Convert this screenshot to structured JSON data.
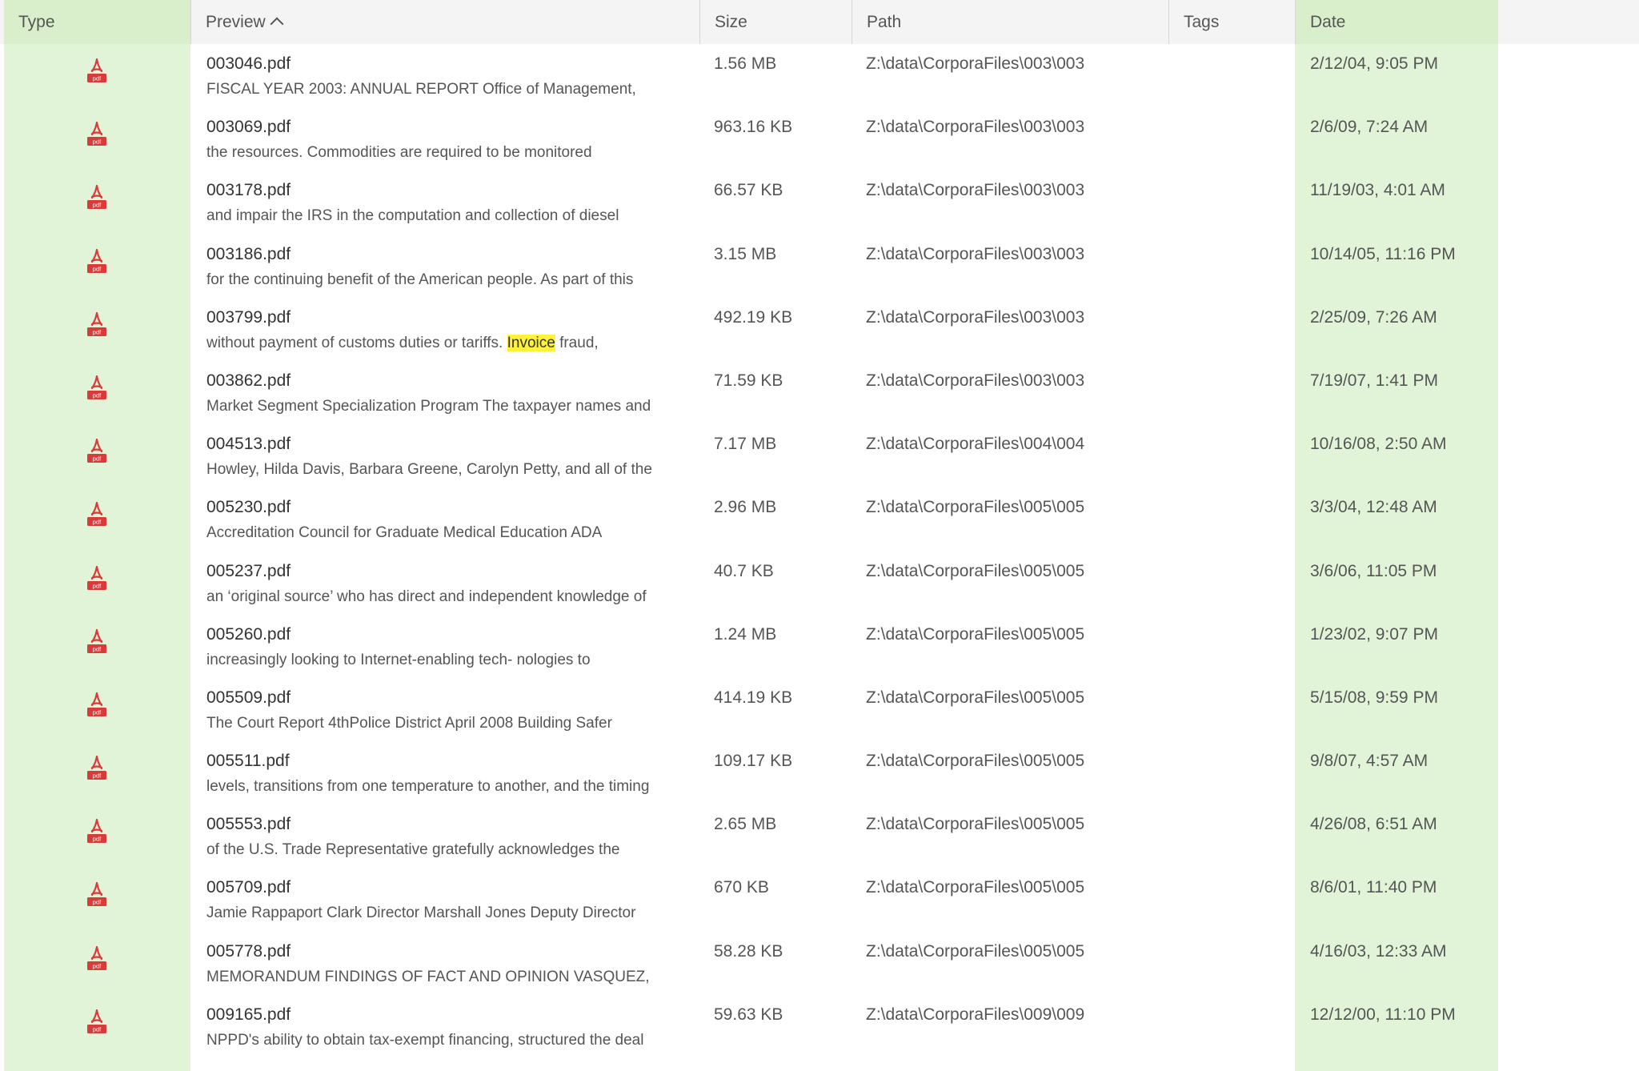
{
  "columns": {
    "type": "Type",
    "preview": "Preview",
    "size": "Size",
    "path": "Path",
    "tags": "Tags",
    "date": "Date"
  },
  "sort": {
    "column": "Preview",
    "direction": "ascending"
  },
  "colors": {
    "column_highlight": "#e2f4d8",
    "search_highlight": "#fff23a",
    "pdf_icon": "#d93a3a"
  },
  "icon": "pdf-file-icon",
  "icon_label": "pdf",
  "rows": [
    {
      "name": "003046.pdf",
      "preview": "FISCAL YEAR 2003: ANNUAL REPORT Office of Management,",
      "size": "1.56 MB",
      "path": "Z:\\data\\CorporaFiles\\003\\003",
      "tags": "",
      "date": "2/12/04, 9:05 PM"
    },
    {
      "name": "003069.pdf",
      "preview": "the resources. Commodities are required to be monitored",
      "size": "963.16 KB",
      "path": "Z:\\data\\CorporaFiles\\003\\003",
      "tags": "",
      "date": "2/6/09, 7:24 AM"
    },
    {
      "name": "003178.pdf",
      "preview": "and impair the IRS in the computation and collection of diesel",
      "size": "66.57 KB",
      "path": "Z:\\data\\CorporaFiles\\003\\003",
      "tags": "",
      "date": "11/19/03, 4:01 AM"
    },
    {
      "name": "003186.pdf",
      "preview": "for the continuing benefit of the American people. As part of this",
      "size": "3.15 MB",
      "path": "Z:\\data\\CorporaFiles\\003\\003",
      "tags": "",
      "date": "10/14/05, 11:16 PM"
    },
    {
      "name": "003799.pdf",
      "preview": "without payment of customs duties or tariffs. ",
      "preview_highlight": "Invoice",
      "preview_after": " fraud,",
      "size": "492.19 KB",
      "path": "Z:\\data\\CorporaFiles\\003\\003",
      "tags": "",
      "date": "2/25/09, 7:26 AM"
    },
    {
      "name": "003862.pdf",
      "preview": "Market Segment Specialization Program The taxpayer names and",
      "size": "71.59 KB",
      "path": "Z:\\data\\CorporaFiles\\003\\003",
      "tags": "",
      "date": "7/19/07, 1:41 PM"
    },
    {
      "name": "004513.pdf",
      "preview": "Howley, Hilda Davis, Barbara Greene, Carolyn Petty, and all of the",
      "size": "7.17 MB",
      "path": "Z:\\data\\CorporaFiles\\004\\004",
      "tags": "",
      "date": "10/16/08, 2:50 AM"
    },
    {
      "name": "005230.pdf",
      "preview": "Accreditation Council for Graduate Medical Education ADA",
      "size": "2.96 MB",
      "path": "Z:\\data\\CorporaFiles\\005\\005",
      "tags": "",
      "date": "3/3/04, 12:48 AM"
    },
    {
      "name": "005237.pdf",
      "preview": "an ‘original source’ who has direct and independent knowledge of",
      "size": "40.7 KB",
      "path": "Z:\\data\\CorporaFiles\\005\\005",
      "tags": "",
      "date": "3/6/06, 11:05 PM"
    },
    {
      "name": "005260.pdf",
      "preview": "increasingly looking to Internet-enabling tech- nologies to",
      "size": "1.24 MB",
      "path": "Z:\\data\\CorporaFiles\\005\\005",
      "tags": "",
      "date": "1/23/02, 9:07 PM"
    },
    {
      "name": "005509.pdf",
      "preview": "The Court Report 4thPolice District April 2008 Building Safer",
      "size": "414.19 KB",
      "path": "Z:\\data\\CorporaFiles\\005\\005",
      "tags": "",
      "date": "5/15/08, 9:59 PM"
    },
    {
      "name": "005511.pdf",
      "preview": "levels, transitions from one temperature to another, and the timing",
      "size": "109.17 KB",
      "path": "Z:\\data\\CorporaFiles\\005\\005",
      "tags": "",
      "date": "9/8/07, 4:57 AM"
    },
    {
      "name": "005553.pdf",
      "preview": "of the U.S. Trade Representative gratefully acknowledges the",
      "size": "2.65 MB",
      "path": "Z:\\data\\CorporaFiles\\005\\005",
      "tags": "",
      "date": "4/26/08, 6:51 AM"
    },
    {
      "name": "005709.pdf",
      "preview": "Jamie Rappaport Clark Director Marshall Jones Deputy Director",
      "size": "670 KB",
      "path": "Z:\\data\\CorporaFiles\\005\\005",
      "tags": "",
      "date": "8/6/01, 11:40 PM"
    },
    {
      "name": "005778.pdf",
      "preview": "MEMORANDUM FINDINGS OF FACT AND OPINION VASQUEZ,",
      "size": "58.28 KB",
      "path": "Z:\\data\\CorporaFiles\\005\\005",
      "tags": "",
      "date": "4/16/03, 12:33 AM"
    },
    {
      "name": "009165.pdf",
      "preview": "NPPD's ability to obtain tax-exempt financing, structured the deal",
      "size": "59.63 KB",
      "path": "Z:\\data\\CorporaFiles\\009\\009",
      "tags": "",
      "date": "12/12/00, 11:10 PM"
    },
    {
      "name": "",
      "preview": "",
      "size": "",
      "path": "",
      "tags": "",
      "date": ""
    }
  ]
}
